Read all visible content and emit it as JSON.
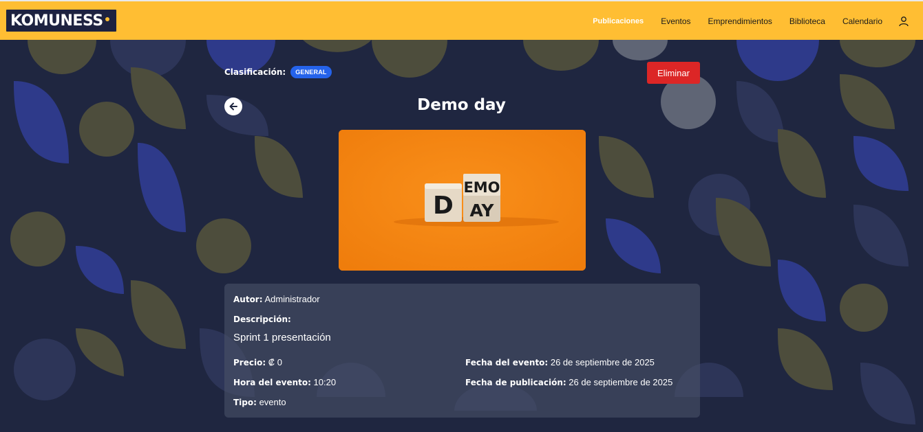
{
  "brand": {
    "logo_text": "KOMUNESS"
  },
  "nav": {
    "items": [
      {
        "label": "Publicaciones",
        "active": true
      },
      {
        "label": "Eventos",
        "active": false
      },
      {
        "label": "Emprendimientos",
        "active": false
      },
      {
        "label": "Biblioteca",
        "active": false
      },
      {
        "label": "Calendario",
        "active": false
      }
    ],
    "user_icon": "user-icon"
  },
  "post": {
    "classification_label": "Clasificación:",
    "classification_value": "GENERAL",
    "delete_label": "Eliminar",
    "back_icon": "arrow-left-icon",
    "title": "Demo day",
    "image": {
      "cube_left": "D",
      "cube_right_top": "EMO",
      "cube_right_bottom": "AY"
    },
    "author_label": "Autor:",
    "author_value": "Administrador",
    "description_label": "Descripción:",
    "description_value": "Sprint 1 presentación",
    "price_label": "Precio:",
    "price_value": "₡ 0",
    "event_time_label": "Hora del evento:",
    "event_time_value": "10:20",
    "type_label": "Tipo:",
    "type_value": "evento",
    "event_date_label": "Fecha del evento:",
    "event_date_value": "26 de septiembre de 2025",
    "pub_date_label": "Fecha de publicación:",
    "pub_date_value": "26 de septiembre de 2025"
  },
  "colors": {
    "navbar": "#ffbe33",
    "background": "#1f2640",
    "badge": "#2563eb",
    "delete": "#dc2626",
    "image_bg": "#f07f0c"
  }
}
